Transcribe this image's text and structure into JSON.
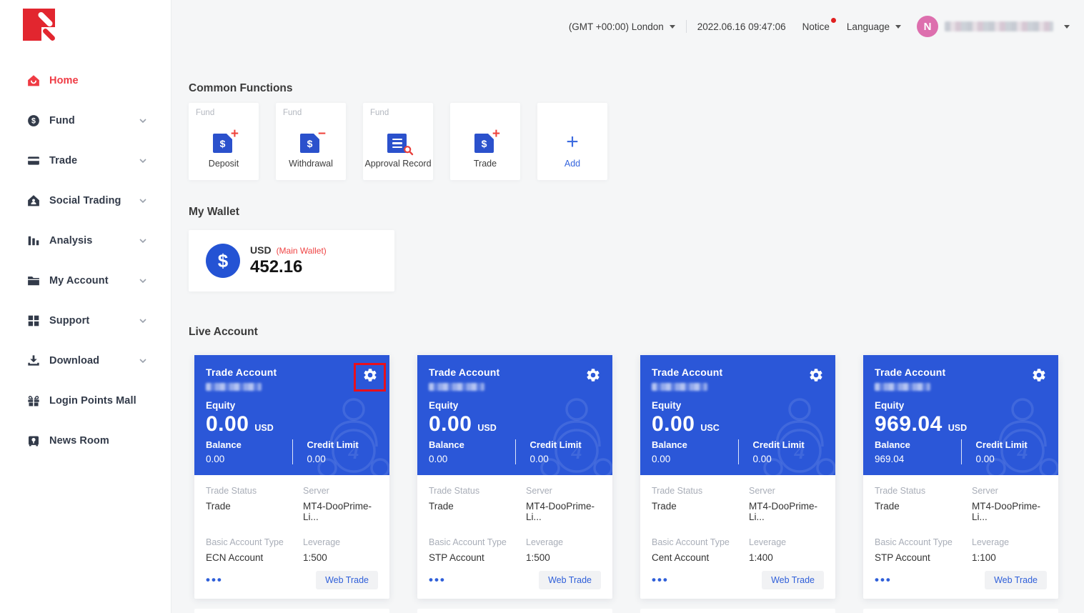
{
  "topbar": {
    "timezone": "(GMT +00:00) London",
    "datetime": "2022.06.16 09:47:06",
    "notice": "Notice",
    "language": "Language",
    "user_initial": "N"
  },
  "sidebar": {
    "items": [
      {
        "label": "Home",
        "icon": "home-icon",
        "active": true,
        "chevron": false
      },
      {
        "label": "Fund",
        "icon": "fund-icon",
        "active": false,
        "chevron": true
      },
      {
        "label": "Trade",
        "icon": "trade-icon",
        "active": false,
        "chevron": true
      },
      {
        "label": "Social Trading",
        "icon": "social-trading-icon",
        "active": false,
        "chevron": true
      },
      {
        "label": "Analysis",
        "icon": "analysis-icon",
        "active": false,
        "chevron": true
      },
      {
        "label": "My Account",
        "icon": "my-account-icon",
        "active": false,
        "chevron": true
      },
      {
        "label": "Support",
        "icon": "support-icon",
        "active": false,
        "chevron": true
      },
      {
        "label": "Download",
        "icon": "download-icon",
        "active": false,
        "chevron": true
      },
      {
        "label": "Login Points Mall",
        "icon": "gift-icon",
        "active": false,
        "chevron": false
      },
      {
        "label": "News Room",
        "icon": "news-icon",
        "active": false,
        "chevron": false
      }
    ]
  },
  "sections": {
    "common_functions": "Common Functions",
    "my_wallet": "My Wallet",
    "live_account": "Live Account"
  },
  "functions": [
    {
      "tag": "Fund",
      "label": "Deposit",
      "icon": "deposit-icon"
    },
    {
      "tag": "Fund",
      "label": "Withdrawal",
      "icon": "withdrawal-icon"
    },
    {
      "tag": "Fund",
      "label": "Approval Record",
      "icon": "approval-record-icon"
    },
    {
      "tag": "",
      "label": "Trade",
      "icon": "trade-fund-icon"
    },
    {
      "tag": "",
      "label": "Add",
      "icon": "add-icon"
    }
  ],
  "wallet": {
    "currency": "USD",
    "tag": "(Main Wallet)",
    "amount": "452.16"
  },
  "account_labels": {
    "title": "Trade Account",
    "equity": "Equity",
    "balance": "Balance",
    "credit_limit": "Credit Limit",
    "trade_status": "Trade Status",
    "server": "Server",
    "basic_account_type": "Basic Account Type",
    "leverage": "Leverage",
    "web_trade": "Web Trade",
    "more": "•••"
  },
  "accounts": [
    {
      "equity": "0.00",
      "currency": "USD",
      "balance": "0.00",
      "credit_limit": "0.00",
      "trade_status": "Trade",
      "server": "MT4-DooPrime-Li...",
      "account_type": "ECN Account",
      "leverage": "1:500"
    },
    {
      "equity": "0.00",
      "currency": "USD",
      "balance": "0.00",
      "credit_limit": "0.00",
      "trade_status": "Trade",
      "server": "MT4-DooPrime-Li...",
      "account_type": "STP Account",
      "leverage": "1:500"
    },
    {
      "equity": "0.00",
      "currency": "USC",
      "balance": "0.00",
      "credit_limit": "0.00",
      "trade_status": "Trade",
      "server": "MT4-DooPrime-Li...",
      "account_type": "Cent Account",
      "leverage": "1:400"
    },
    {
      "equity": "969.04",
      "currency": "USD",
      "balance": "969.04",
      "credit_limit": "0.00",
      "trade_status": "Trade",
      "server": "MT4-DooPrime-Li...",
      "account_type": "STP Account",
      "leverage": "1:100"
    }
  ],
  "colors": {
    "brand_red": "#e2262f",
    "active_red": "#ef3b44",
    "primary_blue": "#2b57d8",
    "icon_blue": "#2b51cc",
    "link_blue": "#2f5fd9",
    "avatar_pink": "#dd6fae",
    "annotation_red": "#e8101c",
    "page_bg": "#f5f6f7"
  }
}
